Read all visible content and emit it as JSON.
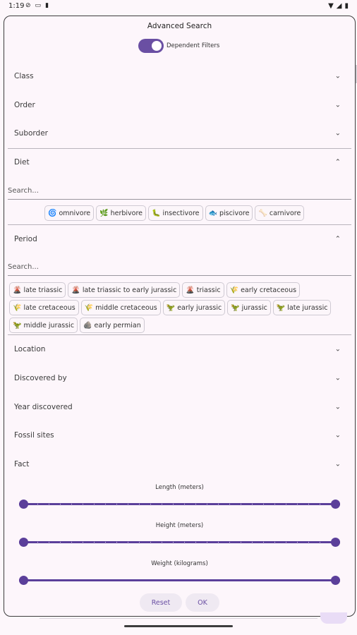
{
  "status": {
    "time": "1:19"
  },
  "dialog": {
    "title": "Advanced Search",
    "dependent_filters": {
      "label": "Dependent Filters",
      "on": true
    },
    "sections": {
      "class": "Class",
      "order": "Order",
      "suborder": "Suborder",
      "diet": "Diet",
      "period": "Period",
      "location": "Location",
      "discovered_by": "Discovered by",
      "year_discovered": "Year discovered",
      "fossil_sites": "Fossil sites",
      "fact": "Fact"
    },
    "diet_search_placeholder": "Search...",
    "period_search_placeholder": "Search...",
    "diet_chips": [
      {
        "icon": "🌀",
        "label": "omnivore"
      },
      {
        "icon": "🌿",
        "label": "herbivore"
      },
      {
        "icon": "🐛",
        "label": "insectivore"
      },
      {
        "icon": "🐟",
        "label": "piscivore"
      },
      {
        "icon": "🦴",
        "label": "carnivore"
      }
    ],
    "period_chips": [
      {
        "icon": "🌋",
        "label": "late triassic"
      },
      {
        "icon": "🌋",
        "label": "late triassic to early jurassic"
      },
      {
        "icon": "🌋",
        "label": "triassic"
      },
      {
        "icon": "🌾",
        "label": "early cretaceous"
      },
      {
        "icon": "🌾",
        "label": "late cretaceous"
      },
      {
        "icon": "🌾",
        "label": "middle cretaceous"
      },
      {
        "icon": "🦖",
        "label": "early jurassic"
      },
      {
        "icon": "🦖",
        "label": "jurassic"
      },
      {
        "icon": "🦖",
        "label": "late jurassic"
      },
      {
        "icon": "🦖",
        "label": "middle jurassic"
      },
      {
        "icon": "🪨",
        "label": "early permian"
      }
    ],
    "sliders": {
      "length": {
        "label": "Length (meters)",
        "min_fraction": 0,
        "max_fraction": 1
      },
      "height": {
        "label": "Height (meters)",
        "min_fraction": 0,
        "max_fraction": 1
      },
      "weight": {
        "label": "Weight (kilograms)",
        "min_fraction": 0,
        "max_fraction": 1
      }
    },
    "buttons": {
      "reset": "Reset",
      "ok": "OK"
    }
  },
  "colors": {
    "accent": "#5b3f9a",
    "switch": "#6a4fa3",
    "background": "#fdf7fb"
  }
}
